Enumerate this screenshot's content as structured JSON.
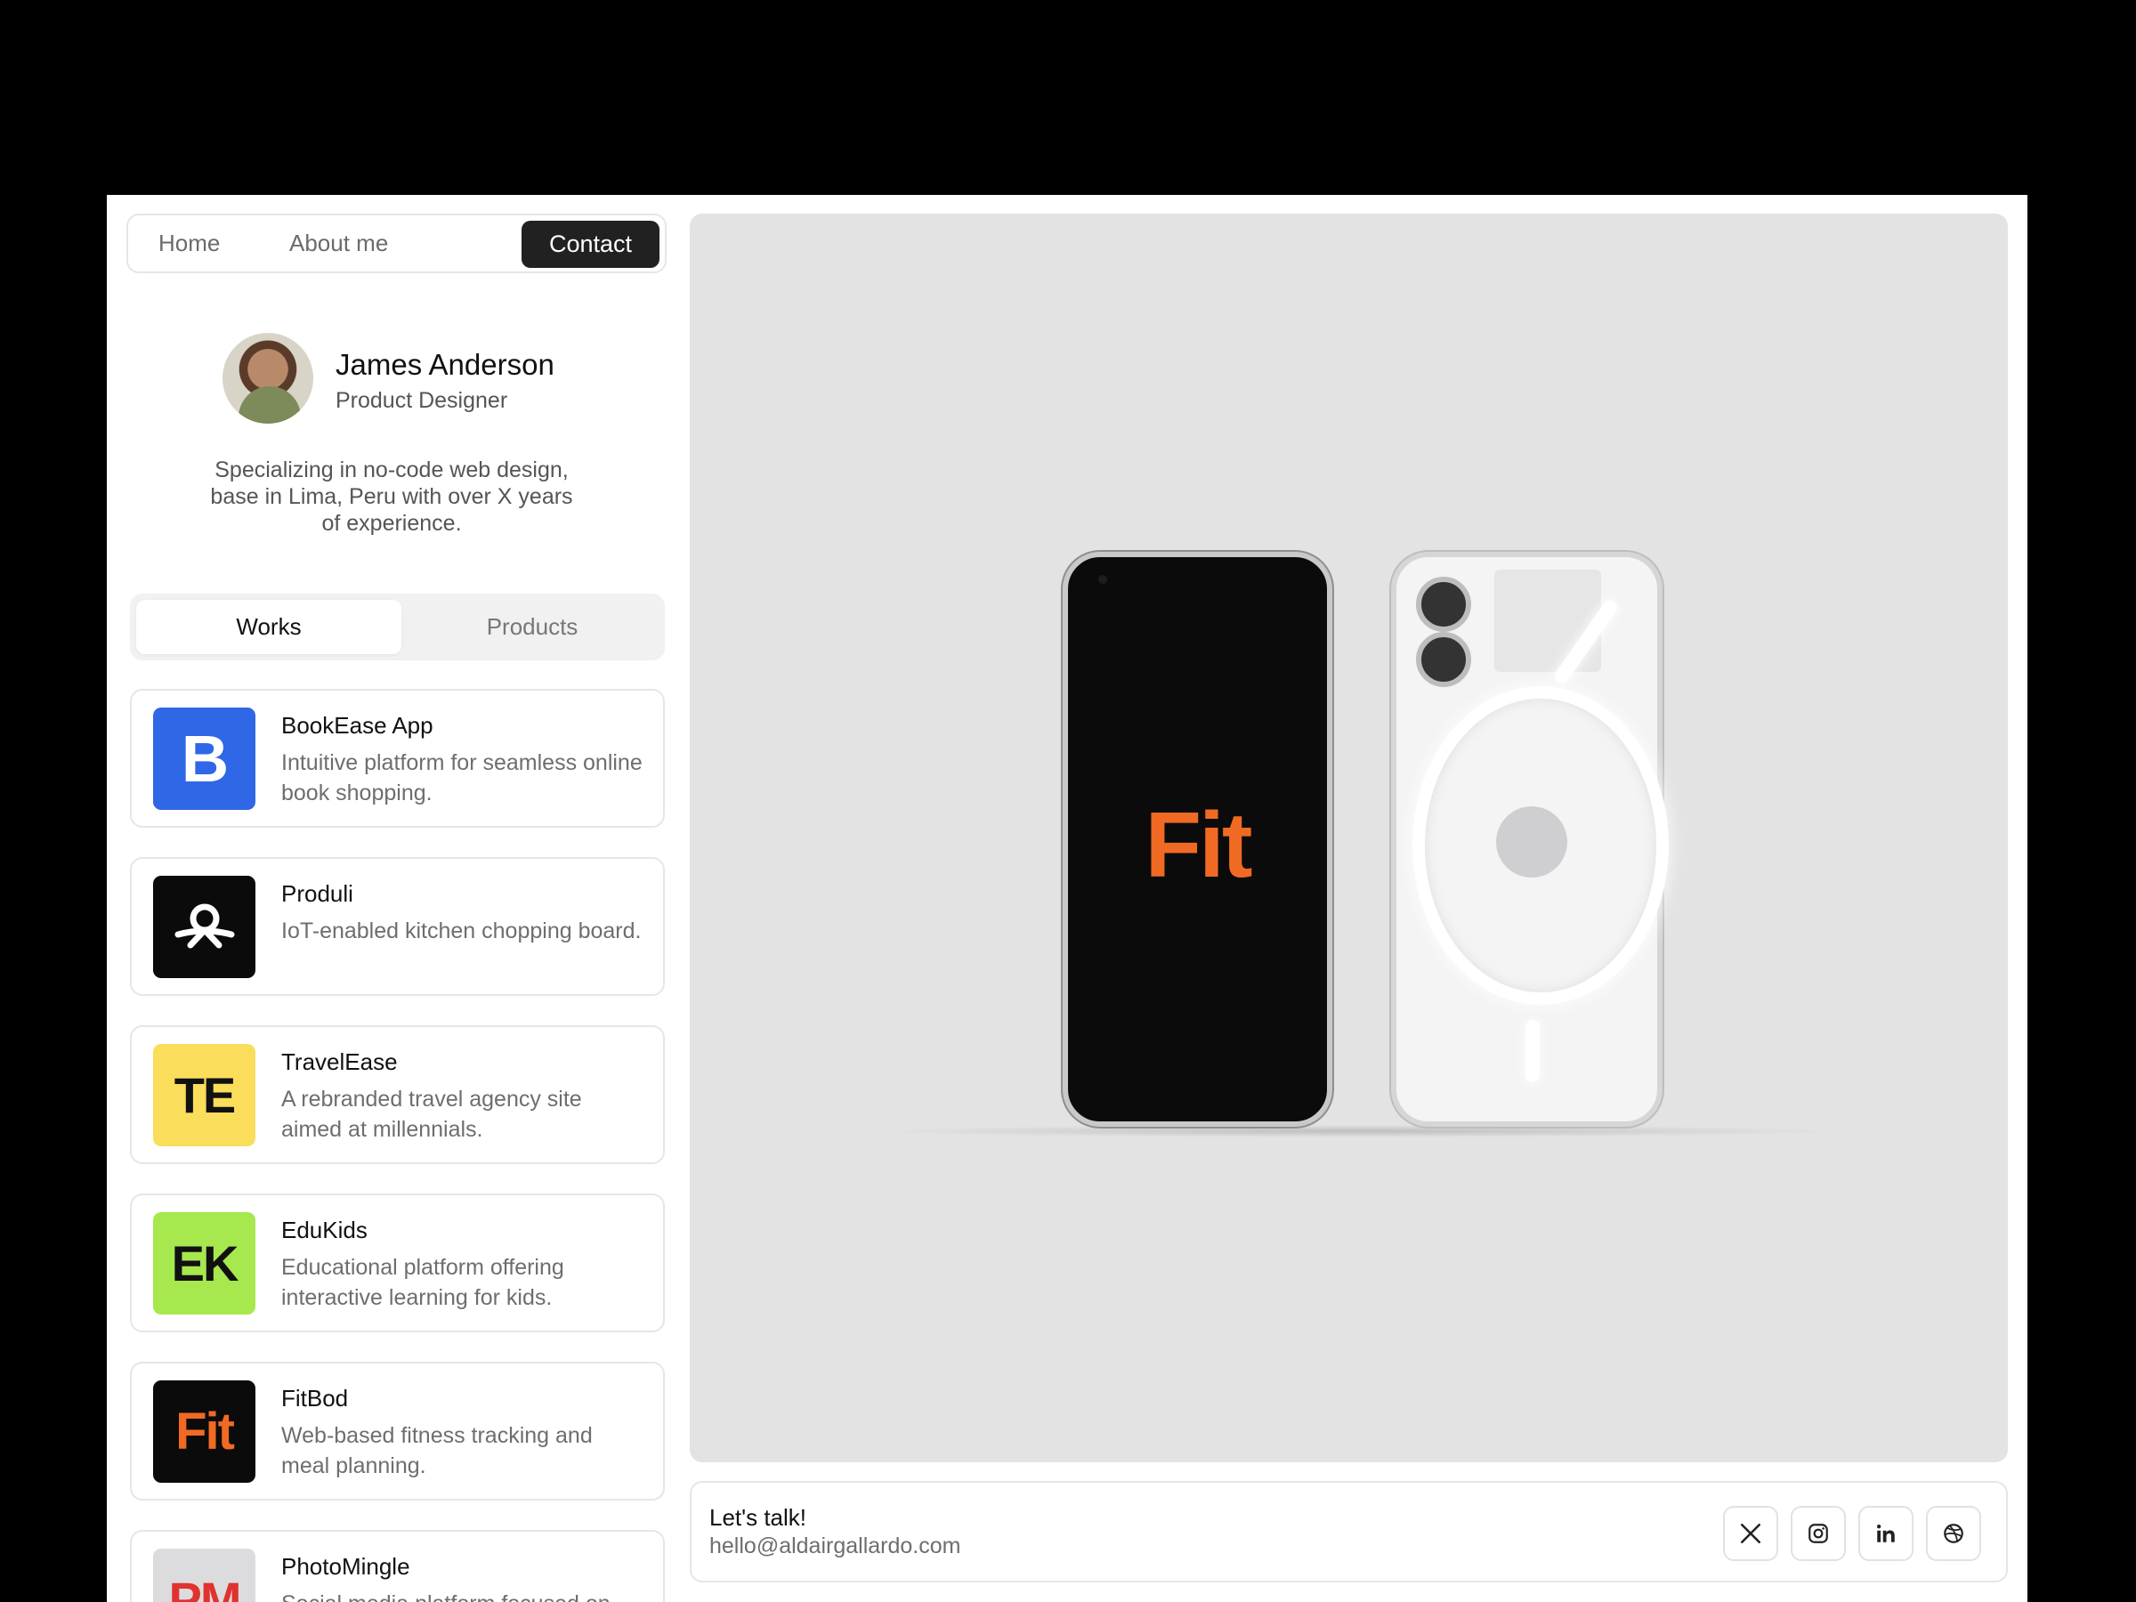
{
  "nav": {
    "home": "Home",
    "about": "About me",
    "contact": "Contact"
  },
  "profile": {
    "name": "James Anderson",
    "role": "Product Designer",
    "bio": "Specializing in no-code web design, base in Lima, Peru with over X years of experience."
  },
  "tabs": {
    "works": "Works",
    "products": "Products",
    "active": "Works"
  },
  "works": [
    {
      "logo": "B",
      "logo_bg": "#2F67E6",
      "logo_fg": "#ffffff",
      "title": "BookEase App",
      "desc": "Intuitive platform for seamless online book shopping."
    },
    {
      "logo": "",
      "logo_icon": "produli-logo-icon",
      "logo_bg": "#0B0B0B",
      "logo_fg": "#ffffff",
      "title": "Produli",
      "desc": "IoT-enabled kitchen chopping board."
    },
    {
      "logo": "TE",
      "logo_bg": "#FADD5A",
      "logo_fg": "#111111",
      "title": "TravelEase",
      "desc": "A rebranded travel agency site aimed at millennials."
    },
    {
      "logo": "EK",
      "logo_bg": "#A6E84E",
      "logo_fg": "#111111",
      "title": "EduKids",
      "desc": "Educational platform offering interactive learning for kids."
    },
    {
      "logo": "Fit",
      "logo_bg": "#0B0B0B",
      "logo_fg": "#F06A24",
      "title": "FitBod",
      "desc": "Web-based fitness tracking and meal planning."
    },
    {
      "logo": "PM",
      "logo_bg": "#DCDCDE",
      "logo_fg": "#E0332F",
      "title": "PhotoMingle",
      "desc": "Social media platform focused on"
    }
  ],
  "hero": {
    "screen_text": "Fit",
    "accent": "#F06A24"
  },
  "contact": {
    "heading": "Let's talk!",
    "email": "hello@aldairgallardo.com",
    "socials": [
      "x-icon",
      "instagram-icon",
      "linkedin-icon",
      "dribbble-icon"
    ]
  }
}
